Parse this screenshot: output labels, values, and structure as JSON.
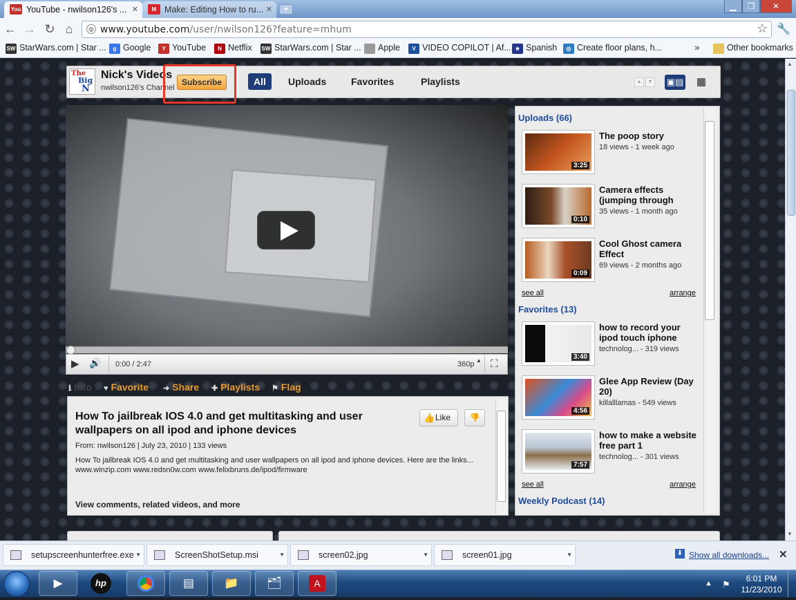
{
  "browser": {
    "tabs": [
      {
        "label": "YouTube - nwilson126's ...",
        "icon": "youtube-favicon"
      },
      {
        "label": "Make: Editing How to ru...",
        "icon": "make-favicon"
      }
    ],
    "url_host": "www.youtube.com",
    "url_path": "/user/nwilson126?feature=mhum",
    "bookmarks": [
      {
        "label": "StarWars.com | Star ...",
        "icon": "starwars-icon"
      },
      {
        "label": "Google",
        "icon": "google-icon"
      },
      {
        "label": "YouTube",
        "icon": "youtube-icon"
      },
      {
        "label": "Netflix",
        "icon": "netflix-icon"
      },
      {
        "label": "StarWars.com | Star ...",
        "icon": "starwars-icon"
      },
      {
        "label": "Apple",
        "icon": "apple-icon"
      },
      {
        "label": "VIDEO COPILOT | Af...",
        "icon": "videocopilot-icon"
      },
      {
        "label": "Spanish",
        "icon": "star-icon"
      },
      {
        "label": "Create floor plans, h...",
        "icon": "floorplan-icon"
      }
    ],
    "other_bookmarks": "Other bookmarks",
    "overflow": "»"
  },
  "channel": {
    "logo_text": [
      "The",
      "Big",
      "N"
    ],
    "name": "Nick's Videos",
    "subtitle": "nwilson126's Channel",
    "subscribe": "Subscribe",
    "tabs": [
      "All",
      "Uploads",
      "Favorites",
      "Playlists"
    ],
    "selected_tab": "All"
  },
  "player": {
    "time": "0:00 / 2:47",
    "quality": "360p"
  },
  "actions": {
    "info": "Info",
    "favorite": "Favorite",
    "share": "Share",
    "playlists": "Playlists",
    "flag": "Flag"
  },
  "video_info": {
    "title": "How To jailbreak IOS 4.0 and get multitasking and user wallpapers on all ipod and iphone devices",
    "like": "Like",
    "meta": "From: nwilson126 | July 23, 2010 | 133 views",
    "description": "How To jailbreak IOS 4.0 and get multitasking and user wallpapers on all ipod and iphone devices. Here are the links... www.winzip.com www.redsn0w.com www.felixbruns.de/ipod/firmware",
    "more": "View comments, related videos, and more"
  },
  "sidebar": {
    "uploads_heading": "Uploads (66)",
    "uploads": [
      {
        "title": "The poop story",
        "meta": "18 views - 1 week ago",
        "duration": "3:25"
      },
      {
        "title": "Camera effects (jumping through",
        "meta": "35 views - 1 month ago",
        "duration": "0:10"
      },
      {
        "title": "Cool Ghost camera Effect",
        "meta": "69 views - 2 months ago",
        "duration": "0:09"
      }
    ],
    "favorites_heading": "Favorites (13)",
    "favorites": [
      {
        "title": "how to record your ipod touch iphone",
        "meta": "technolog... - 319 views",
        "duration": "3:40"
      },
      {
        "title": "Glee App Review (Day 20)",
        "meta": "killalllamas - 549 views",
        "duration": "4:56"
      },
      {
        "title": "how to make a website free part 1",
        "meta": "technolog... - 301 views",
        "duration": "7:57"
      }
    ],
    "podcast_heading": "Weekly Podcast (14)",
    "see_all": "see all",
    "arrange": "arrange"
  },
  "downloads": {
    "items": [
      "setupscreenhunterfree.exe",
      "ScreenShotSetup.msi",
      "screen02.jpg",
      "screen01.jpg"
    ],
    "show_all": "Show all downloads..."
  },
  "taskbar": {
    "time": "6:01 PM",
    "date": "11/23/2010"
  },
  "colors": {
    "accent_blue": "#1e3d78",
    "action_orange": "#e8992e",
    "subscribe_highlight": "#e2372a",
    "section_heading": "#1e4b9a"
  }
}
